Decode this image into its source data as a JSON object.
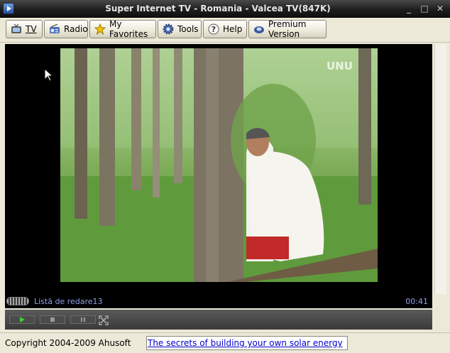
{
  "window": {
    "title": "Super Internet TV - Romania - Valcea TV(847K)",
    "minimize_glyph": "_",
    "maximize_glyph": "□",
    "close_glyph": "✕"
  },
  "toolbar": {
    "tv_label": "TV",
    "radio_label": "Radio",
    "favorites_label": "My Favorites",
    "tools_label": "Tools",
    "help_label": "Help",
    "premium_label": "Premium Version"
  },
  "video": {
    "channel_logo": "UNU"
  },
  "status": {
    "playlist": "Listă de redare13",
    "time": "00:41"
  },
  "footer": {
    "copyright": "Copyright 2004-2009 Ahusoft",
    "ad_link": "The secrets of building your own solar energy"
  }
}
